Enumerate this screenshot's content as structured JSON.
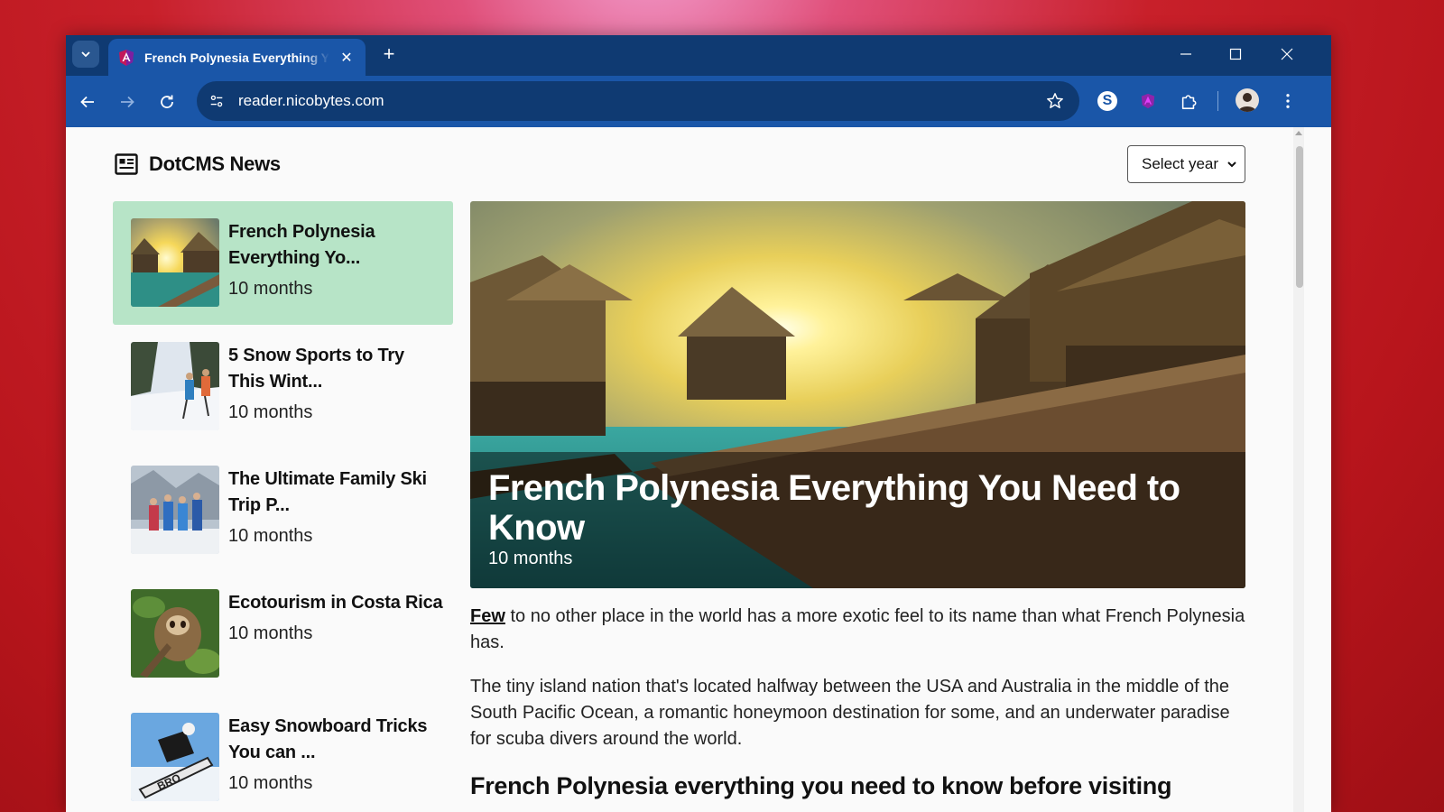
{
  "browser": {
    "tab": {
      "title": "French Polynesia Everything You Need to Know"
    },
    "url": "reader.nicobytes.com"
  },
  "page": {
    "brand": "DotCMS News",
    "year_select": {
      "selected": "Select year"
    },
    "articles": [
      {
        "title": "French Polynesia Everything Yo...",
        "time": "10 months",
        "active": true
      },
      {
        "title": "5 Snow Sports to Try This Wint...",
        "time": "10 months",
        "active": false
      },
      {
        "title": "The Ultimate Family Ski Trip P...",
        "time": "10 months",
        "active": false
      },
      {
        "title": "Ecotourism in Costa Rica",
        "time": "10 months",
        "active": false
      },
      {
        "title": "Easy Snowboard Tricks You can ...",
        "time": "10 months",
        "active": false
      }
    ],
    "hero": {
      "title": "French Polynesia Everything You Need to Know",
      "time": "10 months"
    },
    "article": {
      "lead_word": "Few",
      "p1_rest": " to no other place in the world has a more exotic feel to its name than what French Polynesia has.",
      "p2": "The tiny island nation that's located halfway between the USA and Australia in the middle of the South Pacific Ocean, a romantic honeymoon destination for some, and an underwater paradise for scuba divers around the world.",
      "h2": "French Polynesia everything you need to know before visiting"
    }
  },
  "colors": {
    "tab_strip": "#0f3a72",
    "toolbar": "#1a56a8",
    "active_item": "#b7e4c7"
  }
}
